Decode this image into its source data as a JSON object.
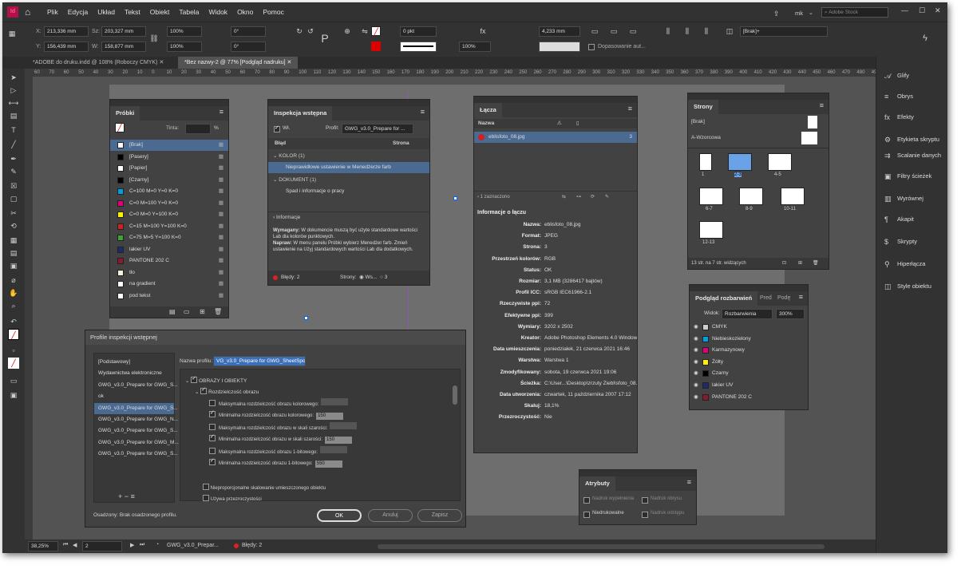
{
  "app": {
    "logo": "Id",
    "menus": [
      "Plik",
      "Edycja",
      "Układ",
      "Tekst",
      "Obiekt",
      "Tabela",
      "Widok",
      "Okno",
      "Pomoc"
    ],
    "user": "mk",
    "search_placeholder": "Adobe Stock"
  },
  "control": {
    "x": "213,336 mm",
    "y": "156,439 mm",
    "w": "203,327 mm",
    "h": "158,877 mm",
    "scale_x": "100%",
    "scale_y": "100%",
    "angle": "0°",
    "shear": "0°",
    "stroke": "0 pkt",
    "size": "4,233 mm",
    "zoom": "100%",
    "fit": "Dopasowanie aut...",
    "style": "[Brak]+"
  },
  "tabs": [
    {
      "label": "*ADOBE do druku.indd @ 108% (Roboczy CMYK)"
    },
    {
      "label": "*Bez nazwy-2 @ 77% [Podgląd nadruku]"
    }
  ],
  "ruler": [
    "60",
    "70",
    "60",
    "50",
    "40",
    "30",
    "20",
    "10",
    "0",
    "10",
    "20",
    "30",
    "40",
    "50",
    "60",
    "70",
    "80",
    "90",
    "100",
    "110",
    "120",
    "130",
    "140",
    "150",
    "160",
    "170",
    "180",
    "190",
    "200",
    "210",
    "220",
    "230",
    "240",
    "250",
    "260",
    "270",
    "280",
    "290",
    "300",
    "310",
    "320",
    "330",
    "340",
    "350",
    "360",
    "370",
    "380",
    "390",
    "400",
    "410",
    "420",
    "430",
    "440",
    "450",
    "460",
    "470",
    "480",
    "490"
  ],
  "swatches": {
    "title": "Próbki",
    "tint_label": "Tinta:",
    "percent": "%",
    "items": [
      {
        "name": "[Brak]",
        "color": "#ffffff"
      },
      {
        "name": "[Pasery]",
        "color": "#000000"
      },
      {
        "name": "[Papier]",
        "color": "#ffffff"
      },
      {
        "name": "[Czarny]",
        "color": "#000000"
      },
      {
        "name": "C=100 M=0 Y=0 K=0",
        "color": "#00a0e0"
      },
      {
        "name": "C=0 M=100 Y=0 K=0",
        "color": "#e0007a"
      },
      {
        "name": "C=0 M=0 Y=100 K=0",
        "color": "#fff000"
      },
      {
        "name": "C=15 M=100 Y=100 K=0",
        "color": "#d01f25"
      },
      {
        "name": "C=75 M=5 Y=100 K=0",
        "color": "#3aa535"
      },
      {
        "name": "lakier UV",
        "color": "#1e2a6a"
      },
      {
        "name": "PANTONE 202 C",
        "color": "#8a1a2e"
      },
      {
        "name": "tło",
        "color": "#f5f0d8"
      },
      {
        "name": "na gradient",
        "color": "#ffffff"
      },
      {
        "name": "pod tekst",
        "color": "#ffffff"
      }
    ]
  },
  "preflight": {
    "title": "Inspekcja wstępna",
    "on": "Wł.",
    "profile_label": "Profil:",
    "profile": "GWG_v3.0_Prepare for ...",
    "col_error": "Błąd",
    "col_page": "Strona",
    "items": [
      "KOLOR (1)",
      "Nieprawidłowe ustawienie w Menedżerze farb",
      "DOKUMENT (1)",
      "Spad i informacje o pracy"
    ],
    "info_title": "Informacje",
    "required_label": "Wymagany:",
    "required": "W dokumencie muszą być użyte standardowe wartości Lab dla kolorów punktowych.",
    "fix_label": "Napraw:",
    "fix": "W menu panelu Próbki wybierz Menedżer farb. Zmień ustawienie na Użyj standardowych wartości Lab dla dodatkowych.",
    "errors": "Błędy: 2",
    "pages_label": "Strony:",
    "pages_all": "Ws...",
    "pages_count": "3"
  },
  "links": {
    "title": "Łącza",
    "col_name": "Nazwa",
    "file": "eblisfoto_08.jpg",
    "file_page": "3",
    "selected": "1 zaznaczono",
    "info_title": "Informacje o łączu",
    "rows": [
      {
        "k": "Nazwa:",
        "v": "eblisfoto_08.jpg"
      },
      {
        "k": "Format:",
        "v": "JPEG"
      },
      {
        "k": "Strona:",
        "v": "3"
      },
      {
        "k": "Przestrzeń kolorów:",
        "v": "RGB"
      },
      {
        "k": "Status:",
        "v": "OK"
      },
      {
        "k": "Rozmiar:",
        "v": "3,1 MB (3286417 bajtów)"
      },
      {
        "k": "Profil ICC:",
        "v": "sRGB IEC61966-2.1"
      },
      {
        "k": "Rzeczywiste ppi:",
        "v": "72"
      },
      {
        "k": "Efektywne ppi:",
        "v": "399"
      },
      {
        "k": "Wymiary:",
        "v": "3202 x 2502"
      },
      {
        "k": "Kreator:",
        "v": "Adobe Photoshop Elements 4.0 Windows"
      },
      {
        "k": "Data umieszczenia:",
        "v": "poniedziałek, 21 czerwca 2021 16:46"
      },
      {
        "k": "Warstwa:",
        "v": "Warstwa 1"
      },
      {
        "k": "Zmodyfikowany:",
        "v": "sobota, 19 czerwca 2021 19:06"
      },
      {
        "k": "Ścieżka:",
        "v": "C:\\User...\\Desktop\\zrzuty Ziebl\\sfoto_08.jpg"
      },
      {
        "k": "Data utworzenia:",
        "v": "czwartek, 11 października 2007 17:12"
      },
      {
        "k": "Skaluj:",
        "v": "18,1%"
      },
      {
        "k": "Przezroczystość:",
        "v": "Nie"
      }
    ]
  },
  "pages": {
    "title": "Strony",
    "none": "[Brak]",
    "master": "A-Wzorcowa",
    "labels": [
      "1",
      "2-3",
      "4-5",
      "6-7",
      "8-9",
      "10-11",
      "12-13"
    ],
    "footer": "13 str. na 7 str. widzących"
  },
  "sep": {
    "tabs": [
      "Podgląd rozbarwień",
      "Pred",
      "Podę"
    ],
    "view_label": "Widok:",
    "view": "Rozbarwienia",
    "zoom": "300%",
    "inks": [
      {
        "name": "CMYK",
        "color": "#cccccc"
      },
      {
        "name": "Niebieskozielony",
        "color": "#00a0e0"
      },
      {
        "name": "Karmazynowy",
        "color": "#e0007a"
      },
      {
        "name": "Żółty",
        "color": "#fff000"
      },
      {
        "name": "Czarny",
        "color": "#000000"
      },
      {
        "name": "lakier UV",
        "color": "#1e2a6a"
      },
      {
        "name": "PANTONE 202 C",
        "color": "#8a1a2e"
      }
    ]
  },
  "attrs": {
    "title": "Atrybuty",
    "fill": "Nadruk wypełnienia",
    "stroke": "Nadruk obrysu",
    "nonprint": "Niedrukowalne",
    "gap": "Nadruk odstępu"
  },
  "dialog": {
    "title": "Profile inspekcji wstępnej",
    "profiles": [
      "[Podstawowy]",
      "Wydawnictwa elektroniczne",
      "GWG_v3.0_Prepare for GWG_S...",
      "ok",
      "GWG_v3.0_Prepare for GWG_S...",
      "GWG_v3.0_Prepare for GWG_N...",
      "GWG_v3.0_Prepare for GWG_S...",
      "GWG_v3.0_Prepare for GWG_M...",
      "GWG_v3.0_Prepare for GWG_S..."
    ],
    "name_label": "Nazwa profilu:",
    "name": "VG_v3.0_Prepare for GWG_SheetSpot_2015",
    "section": "OBRAZY I OBIEKTY",
    "subsection": "Rozdzielczość obrazu",
    "options": [
      {
        "label": "Maksymalna rozdzielczość obrazu kolorowego:",
        "on": false,
        "val": ""
      },
      {
        "label": "Minimalna rozdzielczość obrazu kolorowego:",
        "on": true,
        "val": "150"
      },
      {
        "label": "Maksymalna rozdzielczość obrazu w skali szarości:",
        "on": false,
        "val": ""
      },
      {
        "label": "Minimalna rozdzielczość obrazu w skali szarości:",
        "on": true,
        "val": "150"
      },
      {
        "label": "Maksymalna rozdzielczość obrazu 1-bitowego:",
        "on": false,
        "val": ""
      },
      {
        "label": "Minimalna rozdzielczość obrazu 1-bitowego:",
        "on": true,
        "val": "550"
      }
    ],
    "opt_scale": "Nieproporcjonalne skalowanie umieszczonego obiektu",
    "opt_transp": "Używa przezroczystości",
    "embedded": "Osadzony:  Brak osadzonego profilu.",
    "ok": "OK",
    "cancel": "Anuluj",
    "save": "Zapisz"
  },
  "dock": [
    "Glify",
    "Obrys",
    "Efekty",
    "Etykieta skryptu",
    "Scalanie danych",
    "Filtry ścieżek",
    "Wyrównej",
    "Akapit",
    "Skrypty",
    "Hiperłącza",
    "Style obiektu"
  ],
  "status": {
    "zoom": "38,25%",
    "page": "2",
    "profile": "GWG_v3.0_Prepar...",
    "errors": "Błędy: 2"
  }
}
